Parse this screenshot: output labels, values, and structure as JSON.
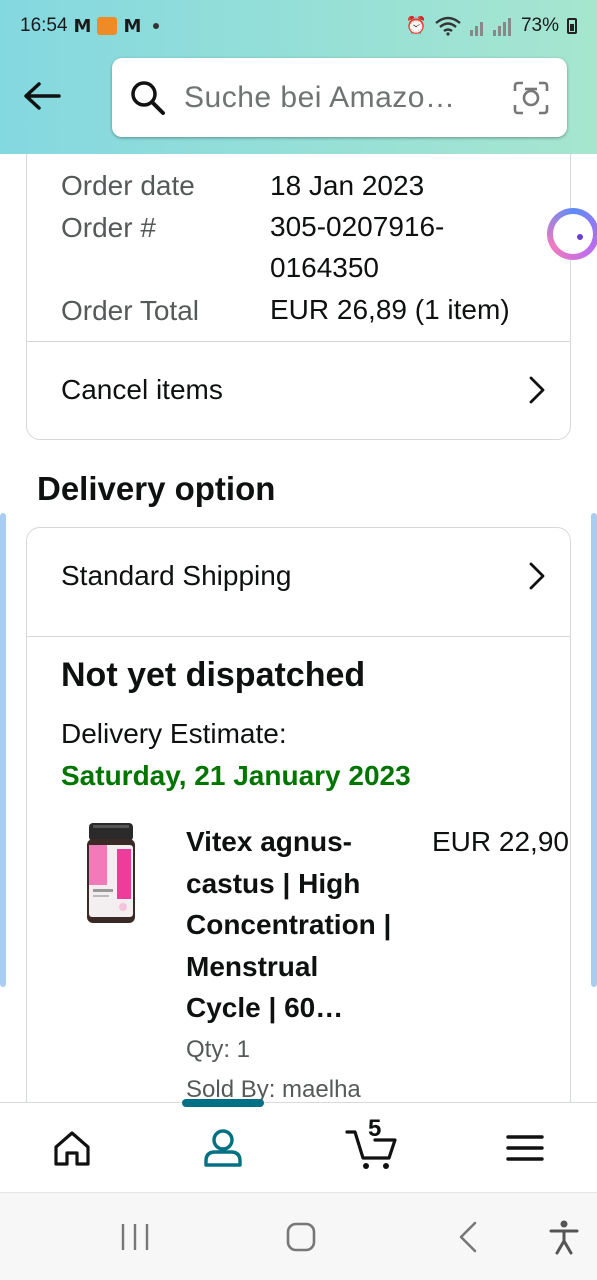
{
  "status_bar": {
    "time": "16:54",
    "battery": "73%"
  },
  "search": {
    "placeholder": "Suche bei Amazo…"
  },
  "order_info": {
    "order_date_label": "Order date",
    "order_date_value": "18 Jan 2023",
    "order_number_label": "Order #",
    "order_number_line1": "305-0207916-",
    "order_number_line2": "0164350",
    "order_total_label": "Order Total",
    "order_total_value": "EUR 26,89 (1 item)"
  },
  "cancel_items_label": "Cancel items",
  "delivery": {
    "section_title": "Delivery option",
    "shipping_label": "Standard Shipping",
    "status_title": "Not yet dispatched",
    "estimate_label": "Delivery Estimate:",
    "estimate_date": "Saturday, 21 January 2023",
    "status_color": "#007600"
  },
  "product": {
    "name_lines": [
      "Vitex agnus-",
      "castus | High",
      "Concentration |",
      "Menstrual",
      "Cycle | 60…"
    ],
    "price": "EUR 22,90",
    "qty": "Qty: 1",
    "seller": "Sold By: maelha"
  },
  "bottom_nav": {
    "cart_count": "5",
    "active_color": "#007185"
  }
}
